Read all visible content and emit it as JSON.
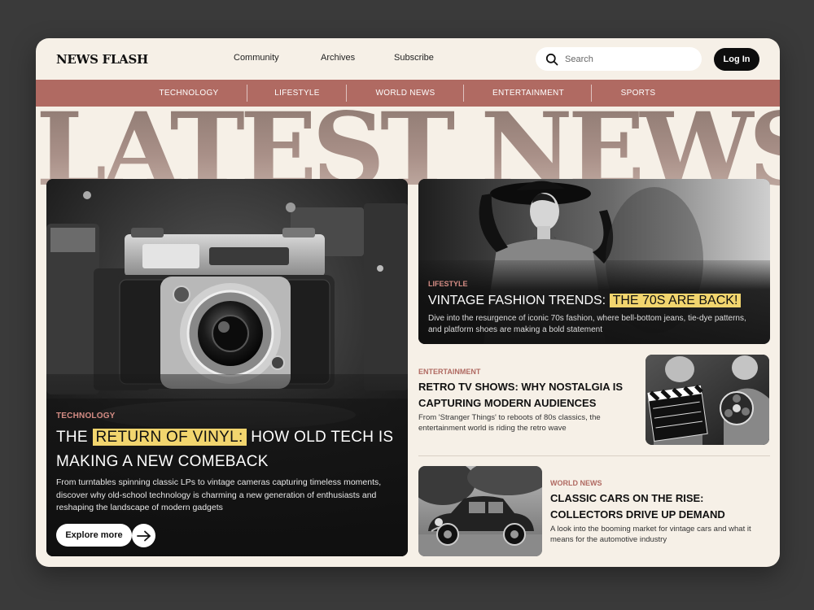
{
  "header": {
    "logo": "NEWS FLASH",
    "nav": [
      "Community",
      "Archives",
      "Subscribe"
    ],
    "search_placeholder": "Search",
    "login_label": "Log In"
  },
  "categories": [
    "TECHNOLOGY",
    "LIFESTYLE",
    "WORLD NEWS",
    "ENTERTAINMENT",
    "SPORTS"
  ],
  "hero_title": "LATEST NEWS",
  "feature": {
    "category": "TECHNOLOGY",
    "title_pre": "THE",
    "title_highlight": "RETURN OF VINYL:",
    "title_post": "HOW OLD TECH IS MAKING A NEW COMEBACK",
    "description": "From turntables spinning classic LPs to vintage cameras capturing timeless moments, discover why old-school technology is charming a new generation of enthusiasts and reshaping the landscape of modern gadgets",
    "button_label": "Explore more"
  },
  "articles": [
    {
      "category": "LIFESTYLE",
      "title_main": "VINTAGE FASHION TRENDS:",
      "title_highlight": "THE 70S ARE BACK!",
      "description": "Dive into the resurgence of iconic 70s fashion, where bell-bottom jeans, tie-dye patterns, and platform shoes are making a bold statement"
    },
    {
      "category": "ENTERTAINMENT",
      "title": "RETRO TV SHOWS: WHY NOSTALGIA IS CAPTURING MODERN AUDIENCES",
      "description": "From 'Stranger Things' to reboots of 80s classics, the entertainment world is riding the retro wave"
    },
    {
      "category": "WORLD NEWS",
      "title": "CLASSIC CARS ON THE RISE: COLLECTORS DRIVE UP DEMAND",
      "description": "A look into the booming market for vintage cars and what it means for the automotive industry"
    }
  ],
  "colors": {
    "background": "#3a3a3a",
    "card": "#f6f0e7",
    "accent": "#b06a62",
    "highlight": "#f2d56e",
    "dark": "#0d0d0d"
  }
}
